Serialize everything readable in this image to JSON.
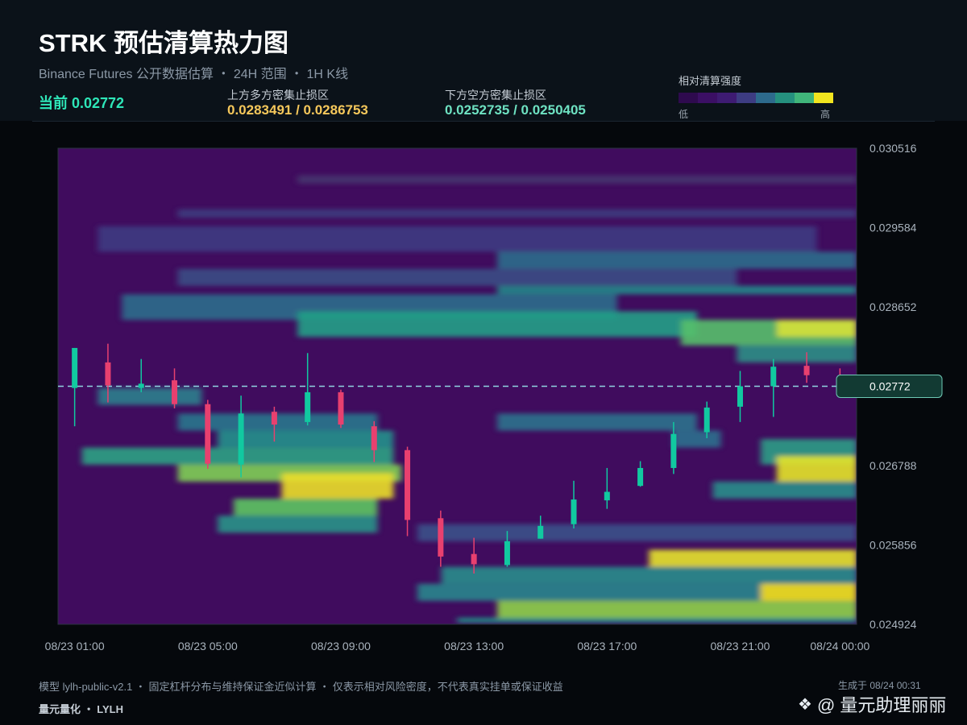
{
  "header": {
    "title": "STRK 预估清算热力图",
    "subtitle": "Binance Futures 公开数据估算 ・ 24H 范围 ・ 1H K线",
    "current_label": "当前 0.02772",
    "upper_zone_label": "上方多方密集止损区",
    "upper_zone_value": "0.0283491 / 0.0286753",
    "lower_zone_label": "下方空方密集止损区",
    "lower_zone_value": "0.0252735 / 0.0250405"
  },
  "legend": {
    "title": "相对清算强度",
    "low": "低",
    "high": "高",
    "colors": [
      "#2e0a4e",
      "#3b0f64",
      "#3e1b72",
      "#3d3c82",
      "#2d6a8c",
      "#25907e",
      "#40b57a",
      "#f2e51f"
    ]
  },
  "footer": {
    "note": "模型 lylh-public-v2.1 ・ 固定杠杆分布与维持保证金近似计算 ・ 仅表示相对风险密度，不代表真实挂单或保证收益",
    "generated": "生成于 08/24 00:31",
    "brand": "量元量化 ・ LYLH",
    "watermark": "@ 量元助理丽丽"
  },
  "colors": {
    "up": "#11c9a0",
    "down": "#e8406f",
    "current_line": "#8fd3e0",
    "price_tag_bg": "#123a33",
    "price_tag_border": "#6fcab6"
  },
  "chart_data": {
    "type": "heatmap",
    "overlay": "candlestick",
    "x_ticks": [
      "08/23 01:00",
      "08/23 05:00",
      "08/23 09:00",
      "08/23 13:00",
      "08/23 17:00",
      "08/23 21:00",
      "08/24 00:00"
    ],
    "y_ticks": [
      "0.030516",
      "0.029584",
      "0.028652",
      "0.027720",
      "0.026788",
      "0.025856",
      "0.024924"
    ],
    "y_tick_values": [
      0.030516,
      0.029584,
      0.028652,
      0.02772,
      0.026788,
      0.025856,
      0.024924
    ],
    "ylim": [
      0.024924,
      0.030516
    ],
    "current_price": 0.02772,
    "current_price_label": "0.02772",
    "candles": [
      {
        "t": "08/23 01:00",
        "o": 0.0277,
        "h": 0.02793,
        "l": 0.02725,
        "c": 0.02817
      },
      {
        "t": "08/23 02:00",
        "o": 0.028,
        "h": 0.02822,
        "l": 0.02753,
        "c": 0.02773
      },
      {
        "t": "08/23 03:00",
        "o": 0.0277,
        "h": 0.02804,
        "l": 0.02765,
        "c": 0.02775
      },
      {
        "t": "08/23 04:00",
        "o": 0.02779,
        "h": 0.02793,
        "l": 0.02746,
        "c": 0.02751
      },
      {
        "t": "08/23 05:00",
        "o": 0.02751,
        "h": 0.02756,
        "l": 0.02675,
        "c": 0.02681
      },
      {
        "t": "08/23 06:00",
        "o": 0.0268,
        "h": 0.02761,
        "l": 0.02665,
        "c": 0.0274
      },
      {
        "t": "08/23 07:00",
        "o": 0.02742,
        "h": 0.02748,
        "l": 0.02707,
        "c": 0.02727
      },
      {
        "t": "08/23 08:00",
        "o": 0.0273,
        "h": 0.02811,
        "l": 0.02726,
        "c": 0.02765
      },
      {
        "t": "08/23 09:00",
        "o": 0.02765,
        "h": 0.02768,
        "l": 0.02723,
        "c": 0.02727
      },
      {
        "t": "08/23 10:00",
        "o": 0.02725,
        "h": 0.02731,
        "l": 0.02683,
        "c": 0.02697
      },
      {
        "t": "08/23 11:00",
        "o": 0.02697,
        "h": 0.02701,
        "l": 0.02596,
        "c": 0.02615
      },
      {
        "t": "08/23 12:00",
        "o": 0.02617,
        "h": 0.02626,
        "l": 0.0256,
        "c": 0.02572
      },
      {
        "t": "08/23 13:00",
        "o": 0.02575,
        "h": 0.02594,
        "l": 0.02552,
        "c": 0.02563
      },
      {
        "t": "08/23 14:00",
        "o": 0.02562,
        "h": 0.02602,
        "l": 0.0256,
        "c": 0.0259
      },
      {
        "t": "08/23 15:00",
        "o": 0.02593,
        "h": 0.0262,
        "l": 0.02593,
        "c": 0.02608
      },
      {
        "t": "08/23 16:00",
        "o": 0.0261,
        "h": 0.02661,
        "l": 0.02605,
        "c": 0.02639
      },
      {
        "t": "08/23 17:00",
        "o": 0.02638,
        "h": 0.02676,
        "l": 0.02628,
        "c": 0.02648
      },
      {
        "t": "08/23 18:00",
        "o": 0.02655,
        "h": 0.02684,
        "l": 0.02654,
        "c": 0.02676
      },
      {
        "t": "08/23 19:00",
        "o": 0.02676,
        "h": 0.0273,
        "l": 0.02669,
        "c": 0.02716
      },
      {
        "t": "08/23 20:00",
        "o": 0.02718,
        "h": 0.02754,
        "l": 0.02711,
        "c": 0.02747
      },
      {
        "t": "08/23 21:00",
        "o": 0.02748,
        "h": 0.0279,
        "l": 0.0273,
        "c": 0.02772
      },
      {
        "t": "08/23 22:00",
        "o": 0.02772,
        "h": 0.02804,
        "l": 0.02736,
        "c": 0.02795
      },
      {
        "t": "08/23 23:00",
        "o": 0.02796,
        "h": 0.02812,
        "l": 0.02776,
        "c": 0.02785
      },
      {
        "t": "08/24 00:00",
        "o": 0.02782,
        "h": 0.02793,
        "l": 0.02768,
        "c": 0.02772
      }
    ]
  }
}
